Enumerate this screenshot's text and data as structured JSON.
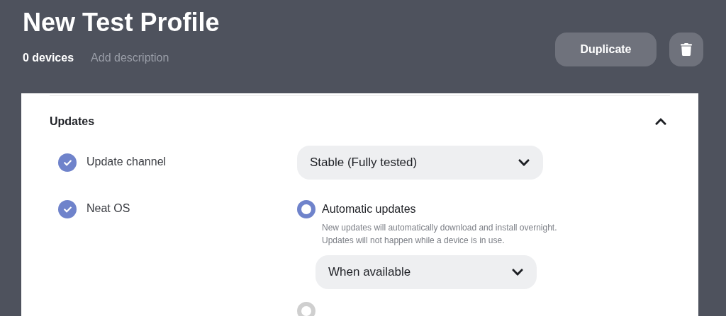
{
  "header": {
    "title": "New Test Profile",
    "device_count": "0 devices",
    "description_placeholder": "Add description",
    "buttons": [
      "Duplicate"
    ]
  },
  "section": {
    "title": "Updates",
    "expanded": true,
    "settings": [
      {
        "kind": "dropdown",
        "label": "Update channel",
        "checked": true,
        "value": "Stable (Fully tested)"
      },
      {
        "kind": "radios",
        "label": "Neat OS",
        "checked": true,
        "options": [
          {
            "label": "Automatic updates",
            "description": "New updates will automatically download and install overnight. Updates will not happen while a device is in use.",
            "selected": true,
            "dropdown": "When available"
          },
          {
            "selected": false
          }
        ]
      }
    ]
  }
}
